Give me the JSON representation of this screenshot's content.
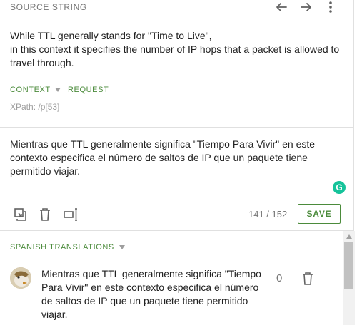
{
  "source": {
    "title": "SOURCE STRING",
    "icons": [
      "arrow-left-icon",
      "arrow-right-icon",
      "more-vert-icon"
    ],
    "text_lines": [
      "While TTL generally stands for \"Time to Live\",",
      "in this context it specifies the number of IP hops that a packet is allowed to travel through."
    ],
    "context_label": "CONTEXT",
    "request_label": "REQUEST",
    "xpath": "XPath: /p[53]"
  },
  "editor": {
    "translation": "Mientras que TTL generalmente significa \"Tiempo Para Vivir\" en este contexto especifica el número de saltos de IP que un paquete tiene permitido viajar.",
    "grammarly_letter": "G",
    "char_counter": "141 / 152",
    "save_label": "SAVE",
    "tool_icons": [
      "copy-source-icon",
      "delete-icon",
      "special-characters-icon"
    ]
  },
  "translations": {
    "title": "SPANISH TRANSLATIONS",
    "items": [
      {
        "text": "Mientras que TTL generalmente significa \"Tiempo Para Vivir\" en este contexto especifica el número de saltos de IP que un paquete tiene permitido viajar.",
        "votes": "0"
      }
    ]
  },
  "colors": {
    "accent": "#4b8b3b",
    "grammarly": "#15c39a",
    "muted": "#757575"
  }
}
